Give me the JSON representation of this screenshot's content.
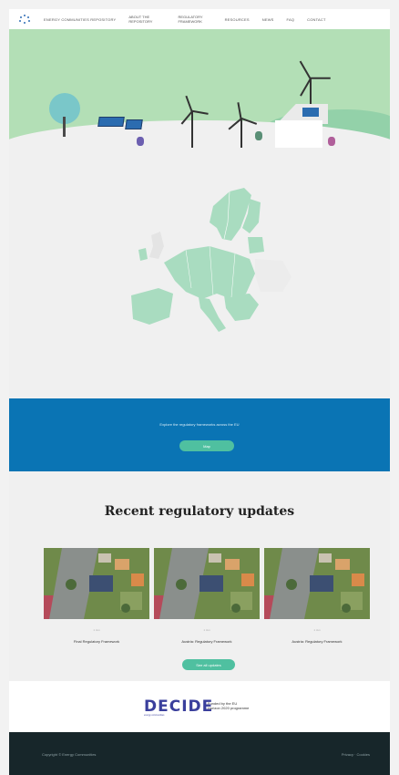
{
  "nav": {
    "logo_label": "ENERGY COMMUNITIES REPOSITORY",
    "items": [
      [
        "ABOUT THE",
        "REPOSITORY"
      ],
      [
        "REGULATORY",
        "FRAMEWORK"
      ],
      [
        "RESOURCES"
      ],
      [
        "NEWS"
      ],
      [
        "FAQ"
      ],
      [
        "CONTACT"
      ]
    ]
  },
  "cta": {
    "text": "Explore the regulatory frameworks across the EU",
    "button_label": "Map"
  },
  "updates": {
    "title": "Recent regulatory updates",
    "cards": [
      {
        "date": "1 Jun",
        "title": "Final Regulatory Framework"
      },
      {
        "date": "1 Jun",
        "title": "Austria: Regulatory Framework"
      },
      {
        "date": "1 Jun",
        "title": "Austria: Regulatory Framework"
      }
    ],
    "more_label": "See all updates"
  },
  "partner": {
    "logo": "DECIDE",
    "logo_sub": "energy communities",
    "text_line1": "Funded by the EU",
    "text_line2": "Horizon 2020 programme"
  },
  "footer": {
    "left": "Copyright © Energy Communities",
    "right": "Privacy · Cookies"
  },
  "colors": {
    "accent": "#0a74b4",
    "button": "#4fc0a0",
    "hero_bg": "#b3dfb6",
    "map_eu": "#a9dcc0",
    "footer_bg": "#17262a"
  }
}
